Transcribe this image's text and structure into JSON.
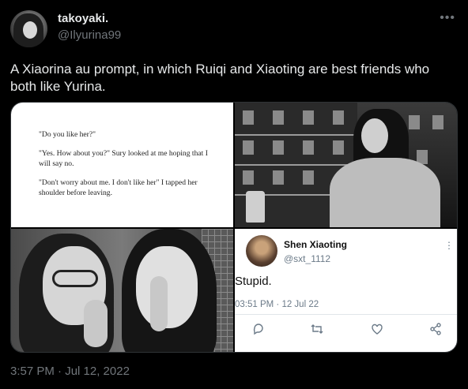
{
  "author": {
    "display_name": "takoyaki.",
    "handle": "@Ilyurina99"
  },
  "more_icon": "more-horizontal-icon",
  "tweet_text": "A Xiaorina au prompt, in which Ruiqi and Xiaoting are best friends who both like Yurina.",
  "media": {
    "book_page": {
      "paragraphs": [
        "\"Do you like her?\"",
        "\"Yes. How about you?\" Sury looked at me hoping that I will say no.",
        "\"Don't worry about me. I don't like her\" I tapped her shoulder before leaving."
      ]
    },
    "embedded_tweet": {
      "name": "Shen Xiaoting",
      "handle": "@sxt_1112",
      "text": "Stupid.",
      "time": "03:51 PM · 12 Jul 22",
      "actions": [
        "reply-icon",
        "retweet-icon",
        "like-icon",
        "share-icon"
      ]
    }
  },
  "timestamp": "3:57 PM · Jul 12, 2022"
}
